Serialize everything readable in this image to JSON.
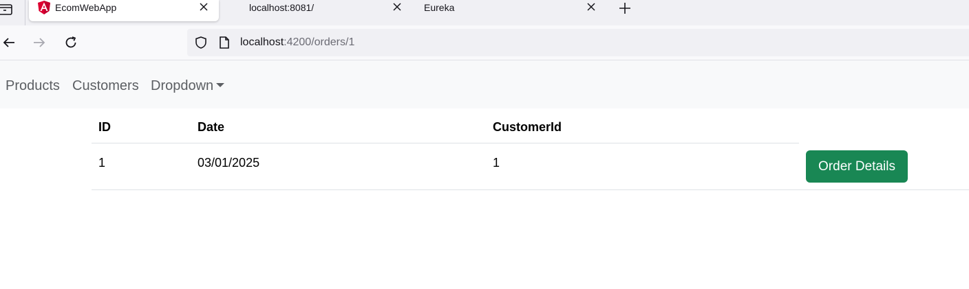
{
  "browser": {
    "tabs": [
      {
        "title": "EcomWebApp",
        "active": true,
        "favicon": "angular-icon"
      },
      {
        "title": "localhost:8081/",
        "active": false
      },
      {
        "title": "Eureka",
        "active": false
      }
    ],
    "address": {
      "host": "localhost",
      "path": ":4200/orders/1"
    }
  },
  "app_nav": {
    "links": [
      "Products",
      "Customers"
    ],
    "dropdown_label": "Dropdown"
  },
  "orders_table": {
    "columns": [
      "ID",
      "Date",
      "CustomerId"
    ],
    "rows": [
      {
        "id": "1",
        "date": "03/01/2025",
        "customer_id": "1",
        "action_label": "Order Details"
      }
    ]
  },
  "colors": {
    "success_button": "#198754",
    "navbar_bg": "#f8f9fa",
    "angular_brand": "#dd0031"
  }
}
